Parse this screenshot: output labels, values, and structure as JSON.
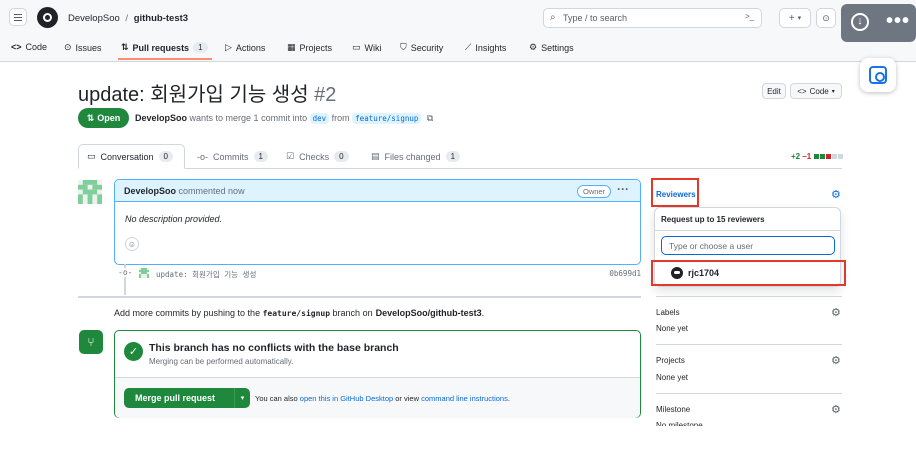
{
  "header": {
    "owner": "DevelopSoo",
    "separator": "/",
    "repo": "github-test3",
    "search_placeholder": "Type / to search",
    "search_kbd": "/",
    "plus_label": "+",
    "new_caret": "▾"
  },
  "repo_nav": {
    "tabs": [
      {
        "label": "Code"
      },
      {
        "label": "Issues"
      },
      {
        "label": "Pull requests",
        "count": "1"
      },
      {
        "label": "Actions"
      },
      {
        "label": "Projects"
      },
      {
        "label": "Wiki"
      },
      {
        "label": "Security"
      },
      {
        "label": "Insights"
      },
      {
        "label": "Settings"
      }
    ]
  },
  "pr": {
    "title": "update: 회원가입 기능 생성",
    "number": "#2",
    "edit_label": "Edit",
    "code_label": "Code",
    "state": "Open",
    "author": "DevelopSoo",
    "merge_text": "wants to merge 1 commit into",
    "base_branch": "dev",
    "from_text": "from",
    "head_branch": "feature/signup"
  },
  "pr_tabs": [
    {
      "label": "Conversation",
      "count": "0"
    },
    {
      "label": "Commits",
      "count": "1"
    },
    {
      "label": "Checks",
      "count": "0"
    },
    {
      "label": "Files changed",
      "count": "1"
    }
  ],
  "diffstat": {
    "added": "+2",
    "removed": "−1"
  },
  "comment": {
    "author": "DevelopSoo",
    "action": "commented now",
    "badge": "Owner",
    "body": "No description provided.",
    "emoji": "☺"
  },
  "commit": {
    "message": "update: 회원가입 기능 생성",
    "sha": "0b699d1"
  },
  "add_more": {
    "prefix": "Add more commits by pushing to the",
    "branch": "feature/signup",
    "middle": "branch on",
    "repo": "DevelopSoo/github-test3",
    "suffix": "."
  },
  "merge": {
    "title": "This branch has no conflicts with the base branch",
    "subtitle": "Merging can be performed automatically.",
    "button": "Merge pull request",
    "also_prefix": "You can also",
    "desktop_link": "open this in GitHub Desktop",
    "or_view": "or view",
    "cli_link": "command line instructions",
    "period": "."
  },
  "sidebar": {
    "reviewers": {
      "label": "Reviewers",
      "popup_title": "Request up to 15 reviewers",
      "input_placeholder": "Type or choose a user",
      "suggested_user": "rjc1704"
    },
    "labels": {
      "label": "Labels",
      "value": "None yet"
    },
    "projects": {
      "label": "Projects",
      "value": "None yet"
    },
    "milestone": {
      "label": "Milestone",
      "value": "No milestone"
    }
  },
  "colors": {
    "open_green": "#1f883d",
    "link_blue": "#0969da",
    "highlight_red": "#e03a2a",
    "comment_border": "#54aeff"
  }
}
